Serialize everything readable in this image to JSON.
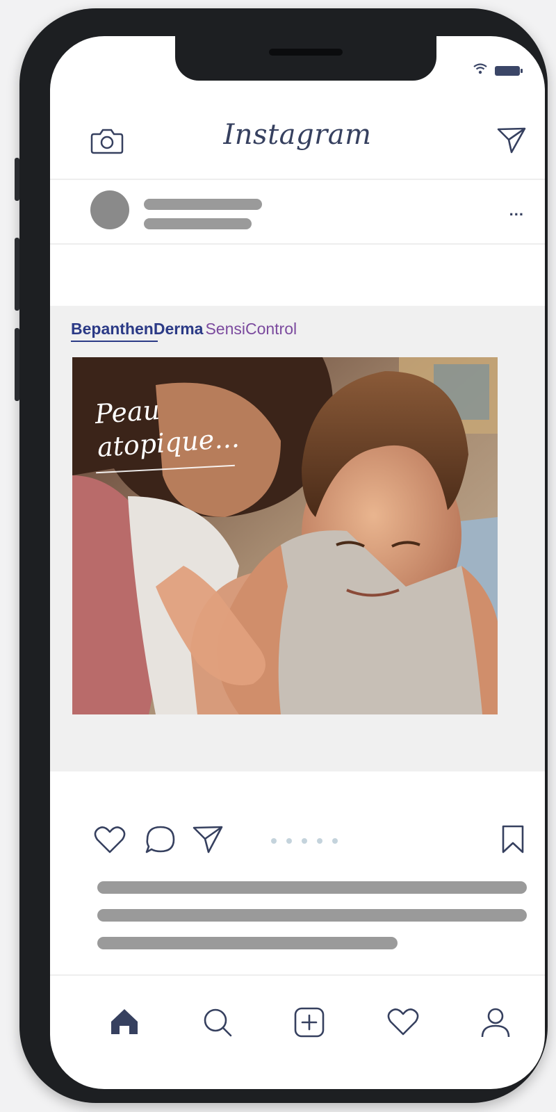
{
  "app": {
    "title": "Instagram"
  },
  "header": {
    "icons": [
      "camera-icon",
      "send-icon"
    ]
  },
  "post": {
    "brand": {
      "main": "BepanthenDerma",
      "sub": "SensiControl"
    },
    "image_text": {
      "line1": "Peau",
      "line2": "atopique..."
    },
    "menu": "..."
  },
  "actions": {
    "icons": [
      "heart-icon",
      "comment-icon",
      "send-icon",
      "bookmark-icon"
    ],
    "carousel_dots": 5
  },
  "nav": {
    "items": [
      "home-icon",
      "search-icon",
      "add-post-icon",
      "activity-heart-icon",
      "profile-icon"
    ]
  },
  "colors": {
    "accent": "#36405f",
    "brand_blue": "#2b3a86",
    "brand_purple": "#7b4a9e",
    "placeholder": "#9a9a9a",
    "frame": "#1d1f22"
  }
}
